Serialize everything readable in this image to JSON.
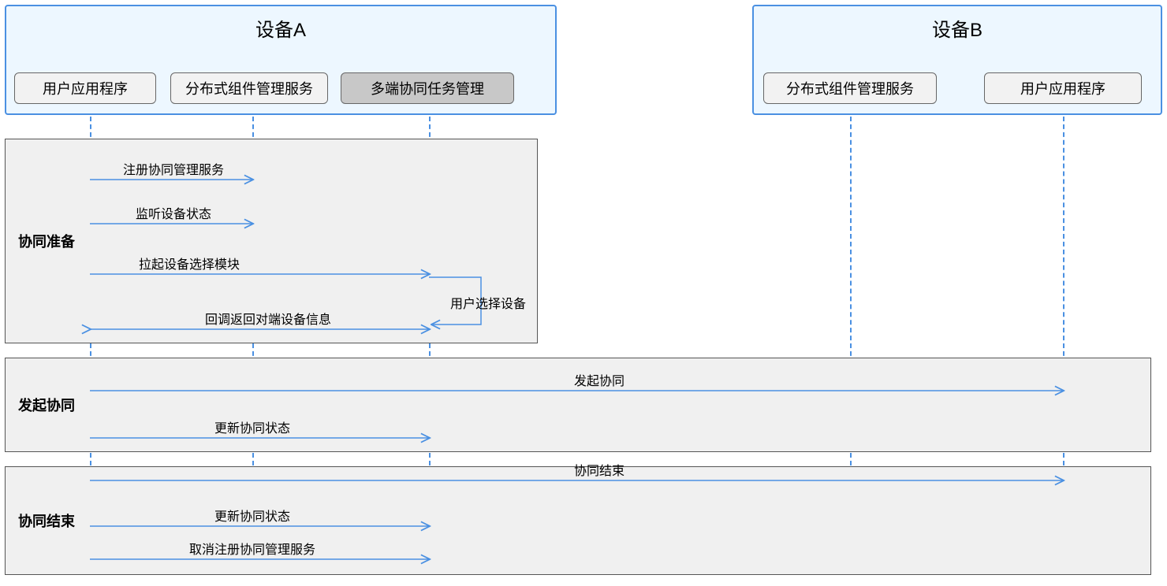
{
  "devices": {
    "a": {
      "title": "设备A"
    },
    "b": {
      "title": "设备B"
    }
  },
  "actors": {
    "userAppA": {
      "label": "用户应用程序"
    },
    "distSvcA": {
      "label": "分布式组件管理服务"
    },
    "multiTask": {
      "label": "多端协同任务管理"
    },
    "distSvcB": {
      "label": "分布式组件管理服务"
    },
    "userAppB": {
      "label": "用户应用程序"
    }
  },
  "phases": {
    "prep": {
      "label": "协同准备"
    },
    "start": {
      "label": "发起协同"
    },
    "end": {
      "label": "协同结束"
    }
  },
  "messages": {
    "m1": "注册协同管理服务",
    "m2": "监听设备状态",
    "m3": "拉起设备选择模块",
    "m4": "用户选择设备",
    "m5": "回调返回对端设备信息",
    "m6": "发起协同",
    "m7": "更新协同状态",
    "m8": "协同结束",
    "m9": "更新协同状态",
    "m10": "取消注册协同管理服务"
  }
}
